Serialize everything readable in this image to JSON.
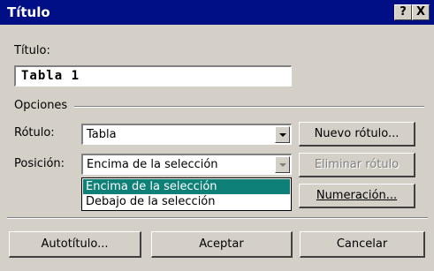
{
  "window": {
    "title": "Título",
    "help_btn": "?",
    "close_btn": "X"
  },
  "caption": {
    "label": "Título:",
    "value": "Tabla 1"
  },
  "options": {
    "group_label": "Opciones",
    "label_label": "Rótulo:",
    "label_value": "Tabla",
    "position_label": "Posición:",
    "position_value": "Encima de la selección",
    "position_options": [
      "Encima de la selección",
      "Debajo de la selección"
    ]
  },
  "buttons": {
    "new_label": "Nuevo rótulo...",
    "delete_label": "Eliminar rótulo",
    "numbering": "Numeración...",
    "autocaption": "Autotítulo...",
    "ok": "Aceptar",
    "cancel": "Cancelar"
  }
}
